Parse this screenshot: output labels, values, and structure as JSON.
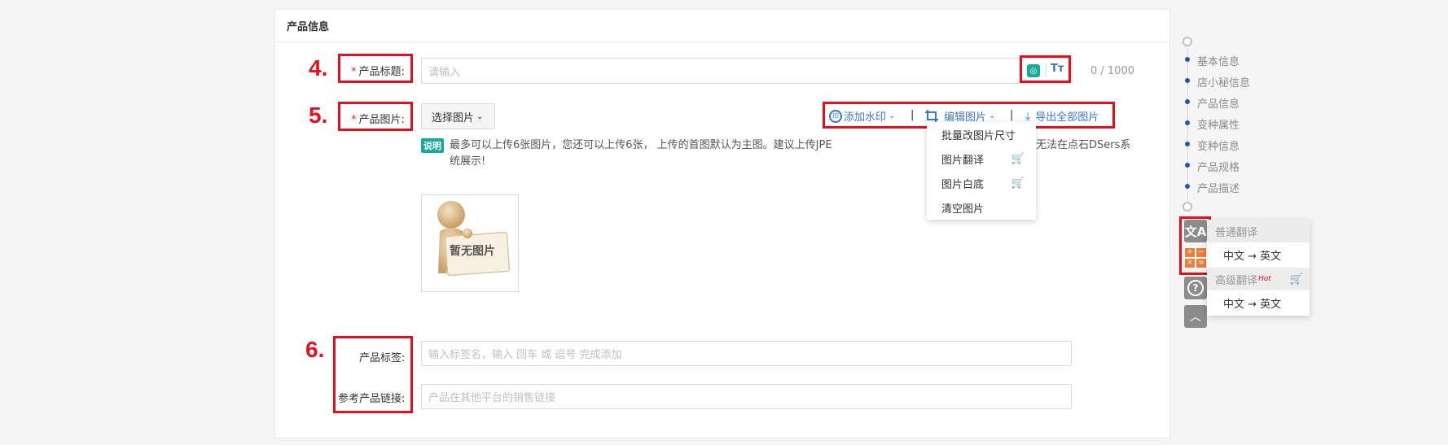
{
  "section": {
    "title": "产品信息"
  },
  "steps": {
    "four": "4.",
    "five": "5.",
    "six": "6."
  },
  "form": {
    "title_label": "产品标题:",
    "required_mark": "*",
    "title_placeholder": "请输入",
    "title_counter": "0 / 1000",
    "images_label": "产品图片:",
    "select_images_button": "选择图片",
    "watermark_link": "添加水印",
    "edit_images_link": "编辑图片",
    "export_all_link": "导出全部图片",
    "separator": "|",
    "edit_menu": [
      "批量改图片尺寸",
      "图片翻译",
      "图片白底",
      "清空图片"
    ],
    "note_tag": "说明",
    "note_line1": "最多可以上传6张图片，您还可以上传6张， 上传的首图默认为主图。建议上传JPEG，PNG，GIF等格式",
    "note_line1_tail": "无法在点石DSers系",
    "note_line2": "统展示!",
    "no_image_text": "暂无图片",
    "tags_label": "产品标签:",
    "tags_placeholder": "输入标签名，输入 回车 或 逗号 完成添加",
    "ref_link_label": "参考产品链接:",
    "ref_link_placeholder": "产品在其他平台的销售链接"
  },
  "right_nav": {
    "items": [
      "基本信息",
      "店小秘信息",
      "产品信息",
      "变种属性",
      "变种信息",
      "产品规格",
      "产品描述"
    ]
  },
  "translate_panel": {
    "normal_header": "普通翻译",
    "normal_option": "中文 → 英文",
    "advanced_header": "高级翻译",
    "hot_badge": "Hot",
    "advanced_option": "中文 → 英文"
  },
  "icons": {
    "ai": "ai-icon",
    "text_size": "text-size-icon",
    "watermark": "watermark-icon",
    "crop": "crop-icon",
    "download": "download-icon",
    "cart": "cart-icon",
    "translate": "translate-icon",
    "calculator": "calculator-icon",
    "help": "help-icon",
    "back_to_top": "back-to-top-icon"
  },
  "colors": {
    "accent": "#3b78c4",
    "annotation_red": "#e0101f",
    "note_tag": "#18a99a"
  }
}
